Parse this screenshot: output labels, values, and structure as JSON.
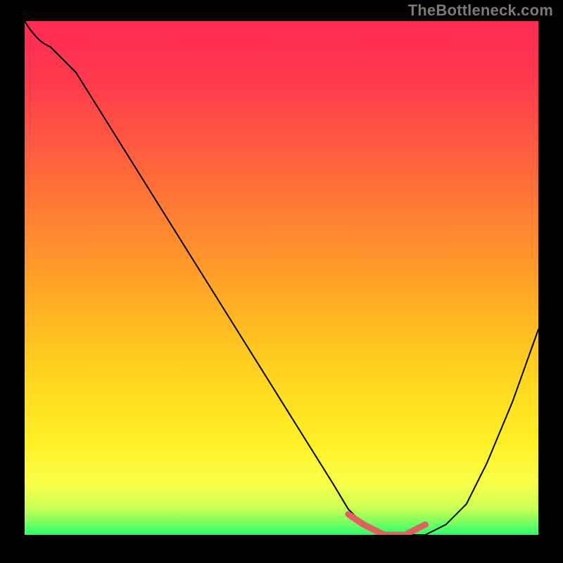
{
  "watermark": "TheBottleneck.com",
  "colors": {
    "frame": "#000000",
    "curve": "#000000",
    "highlight": "#e0615f",
    "gradient_top": "#ff2a55",
    "gradient_bottom": "#2cff6a"
  },
  "chart_data": {
    "type": "line",
    "title": "",
    "xlabel": "",
    "ylabel": "",
    "xlim": [
      0,
      100
    ],
    "ylim": [
      0,
      100
    ],
    "series": [
      {
        "name": "curve",
        "x": [
          0,
          5,
          10,
          15,
          20,
          25,
          30,
          35,
          40,
          45,
          50,
          55,
          60,
          63,
          66,
          70,
          74,
          78,
          82,
          86,
          90,
          95,
          100
        ],
        "y": [
          100,
          95,
          90,
          82,
          74,
          66,
          58,
          50,
          42,
          34,
          26,
          18,
          10,
          5,
          2,
          0,
          0,
          0,
          2,
          6,
          14,
          26,
          40
        ]
      },
      {
        "name": "optimal_flat",
        "x": [
          63,
          66,
          70,
          74,
          78
        ],
        "y": [
          4,
          2,
          0,
          0,
          2
        ]
      }
    ]
  }
}
